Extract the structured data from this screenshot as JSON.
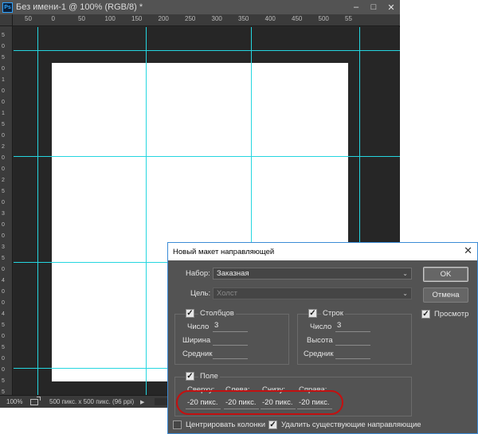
{
  "window": {
    "title": "Без имени-1 @ 100% (RGB/8) *",
    "app_icon": "Ps",
    "minimize": "–",
    "maximize": "□",
    "close": "✕"
  },
  "ruler_h": [
    "50",
    "0",
    "50",
    "100",
    "150",
    "200",
    "250",
    "300",
    "350",
    "400",
    "450",
    "500",
    "55"
  ],
  "ruler_v": [
    "5",
    "0",
    "5",
    "0",
    "1",
    "0",
    "0",
    "1",
    "5",
    "0",
    "2",
    "0",
    "0",
    "2",
    "5",
    "0",
    "3",
    "0",
    "0",
    "3",
    "5",
    "0",
    "4",
    "0",
    "0",
    "4",
    "5",
    "0",
    "5",
    "0",
    "0",
    "5",
    "5"
  ],
  "status": {
    "zoom": "100%",
    "doc_info": "500 пикс. x 500 пикс. (96 ppi)",
    "arrow": "▶"
  },
  "colors": {
    "guide": "#25d6e0",
    "highlight": "#c41010"
  },
  "dialog": {
    "title": "Новый макет направляющей",
    "close": "✕",
    "preset_label": "Набор:",
    "preset_value": "Заказная",
    "target_label": "Цель:",
    "target_value": "Холст",
    "ok": "OK",
    "cancel": "Отмена",
    "preview_label": "Просмотр",
    "preview_checked": true,
    "columns": {
      "title": "Столбцов",
      "checked": true,
      "number_label": "Число",
      "number_value": "3",
      "width_label": "Ширина",
      "width_value": "",
      "gutter_label": "Средник",
      "gutter_value": ""
    },
    "rows": {
      "title": "Строк",
      "checked": true,
      "number_label": "Число",
      "number_value": "3",
      "height_label": "Высота",
      "height_value": "",
      "gutter_label": "Средник",
      "gutter_value": ""
    },
    "margin": {
      "title": "Поле",
      "checked": true,
      "top_label": "Сверху:",
      "left_label": "Слева:",
      "bottom_label": "Снизу:",
      "right_label": "Справа:",
      "top_value": "-20 пикс.",
      "left_value": "-20 пикс.",
      "bottom_value": "-20 пикс.",
      "right_value": "-20 пикс."
    },
    "center_columns_label": "Центрировать колонки",
    "center_columns_checked": false,
    "clear_guides_label": "Удалить существующие направляющие",
    "clear_guides_checked": true
  }
}
